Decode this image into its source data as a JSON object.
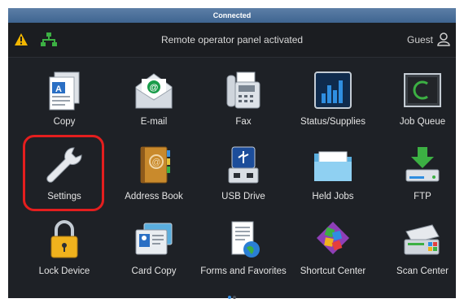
{
  "banner": "Connected",
  "status": {
    "message": "Remote operator panel activated",
    "user": "Guest"
  },
  "icons": {
    "warning": "warning-icon",
    "network": "network-icon",
    "user": "user-icon"
  },
  "apps": [
    {
      "label": "Copy",
      "icon": "copy-icon"
    },
    {
      "label": "E-mail",
      "icon": "email-icon"
    },
    {
      "label": "Fax",
      "icon": "fax-icon"
    },
    {
      "label": "Status/Supplies",
      "icon": "status-supplies-icon"
    },
    {
      "label": "Job Queue",
      "icon": "job-queue-icon"
    },
    {
      "label": "Settings",
      "icon": "wrench-icon"
    },
    {
      "label": "Address Book",
      "icon": "address-book-icon"
    },
    {
      "label": "USB Drive",
      "icon": "usb-drive-icon"
    },
    {
      "label": "Held Jobs",
      "icon": "folder-icon"
    },
    {
      "label": "FTP",
      "icon": "ftp-icon"
    },
    {
      "label": "Lock Device",
      "icon": "padlock-icon"
    },
    {
      "label": "Card Copy",
      "icon": "id-card-icon"
    },
    {
      "label": "Forms and Favorites",
      "icon": "forms-favorites-icon"
    },
    {
      "label": "Shortcut Center",
      "icon": "shortcut-center-icon"
    },
    {
      "label": "Scan Center",
      "icon": "scan-center-icon"
    }
  ],
  "pager": {
    "pages": 2,
    "current": 1
  },
  "colors": {
    "highlight": "#e41e1e",
    "banner": "#4a6f9b",
    "background": "#1e2126"
  }
}
